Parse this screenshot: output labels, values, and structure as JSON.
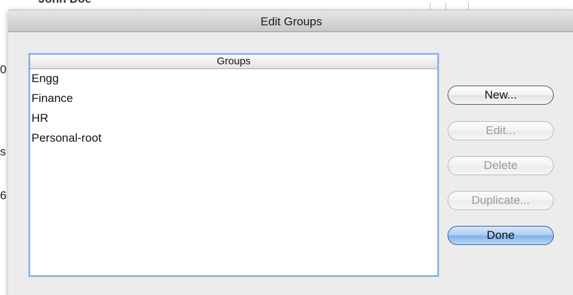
{
  "background": {
    "top_text": "John Doe",
    "left_glyphs": [
      "0",
      "s",
      "6"
    ]
  },
  "dialog": {
    "title": "Edit Groups",
    "list": {
      "header": "Groups",
      "rows": [
        "Engg",
        "Finance",
        "HR",
        "Personal-root"
      ]
    },
    "buttons": {
      "new_label": "New...",
      "edit_label": "Edit...",
      "delete_label": "Delete",
      "duplicate_label": "Duplicate...",
      "done_label": "Done"
    }
  },
  "colors": {
    "focus_ring": "#86aee0",
    "default_button": "#80b1ea",
    "sheet_bg": "#ececec"
  }
}
